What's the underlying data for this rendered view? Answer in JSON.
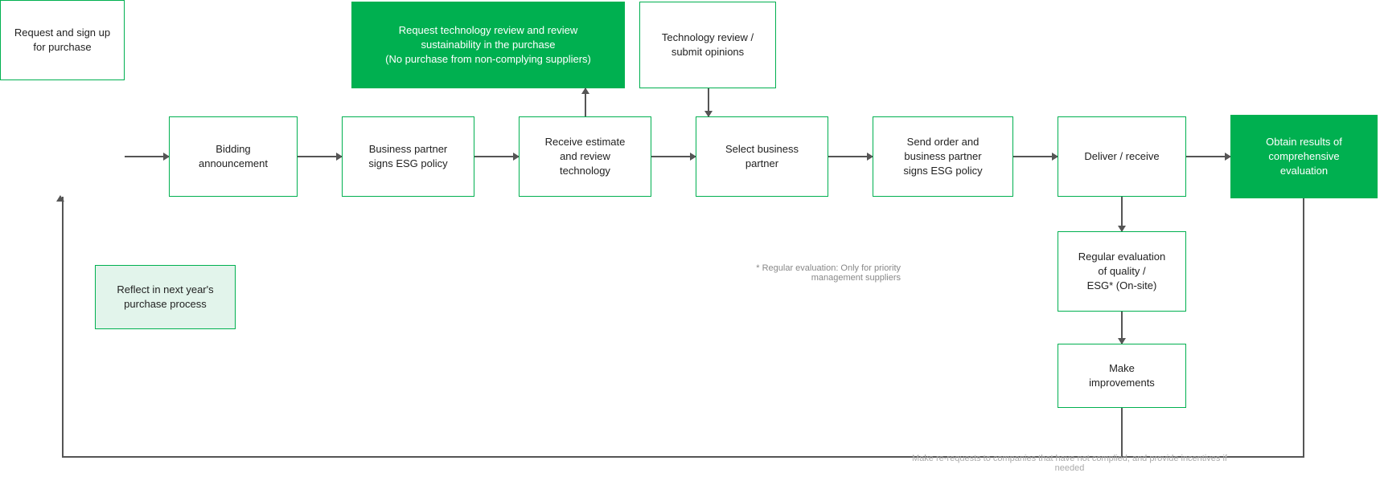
{
  "boxes": {
    "request": "Request and sign up\nfor purchase",
    "bidding": "Bidding\nannouncement",
    "business_partner": "Business partner\nsigns ESG policy",
    "receive_estimate": "Receive estimate\nand review\ntechnology",
    "select_partner": "Select business\npartner",
    "send_order": "Send order and\nbusiness partner\nsigns ESG policy",
    "deliver": "Deliver / receive",
    "obtain_results": "Obtain results of\ncomprehensive\nevaluation",
    "request_tech": "Request technology review and review\nsustainability in the purchase\n(No purchase from non-complying suppliers)",
    "tech_review": "Technology review /\nsubmit opinions",
    "regular_eval": "Regular evaluation\nof quality /\nESG* (On-site)",
    "make_improvements": "Make\nimprovements",
    "reflect": "Reflect in next year's\npurchase process"
  },
  "notes": {
    "regular_eval_note": "* Regular evaluation:\nOnly for priority management suppliers",
    "bottom_note": "Make re-requests to companies that have not\ncomplied, and provide incentives if needed"
  }
}
